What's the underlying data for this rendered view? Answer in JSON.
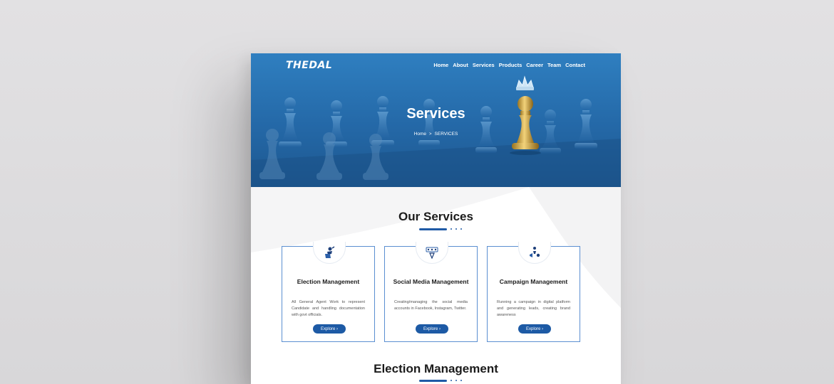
{
  "brand": {
    "logo": "THEDAL"
  },
  "nav": [
    "Home",
    "About",
    "Services",
    "Products",
    "Career",
    "Team",
    "Contact"
  ],
  "hero": {
    "title": "Services",
    "breadcrumb_home": "Home",
    "breadcrumb_sep": ">",
    "breadcrumb_current": "SERVICES"
  },
  "services": {
    "title": "Our Services",
    "cards": [
      {
        "title": "Election Management",
        "text": "All General Agent Work to represent Candidate and handling documentation with govt officials.",
        "button": "Explore",
        "icon": "voter-icon"
      },
      {
        "title": "Social Media Management",
        "text": "Creating/managing the social media accounts in Facebook, Instagram, Twitter.",
        "button": "Explore",
        "icon": "social-network-icon"
      },
      {
        "title": "Campaign Management",
        "text": "Running a campaign in digital platform and generating leads, creating brand awareness",
        "button": "Explore",
        "icon": "megaphone-icon"
      }
    ]
  },
  "next_section": {
    "title": "Election Management"
  },
  "colors": {
    "primary": "#1d5aa5",
    "hero": "#2a72b5"
  }
}
